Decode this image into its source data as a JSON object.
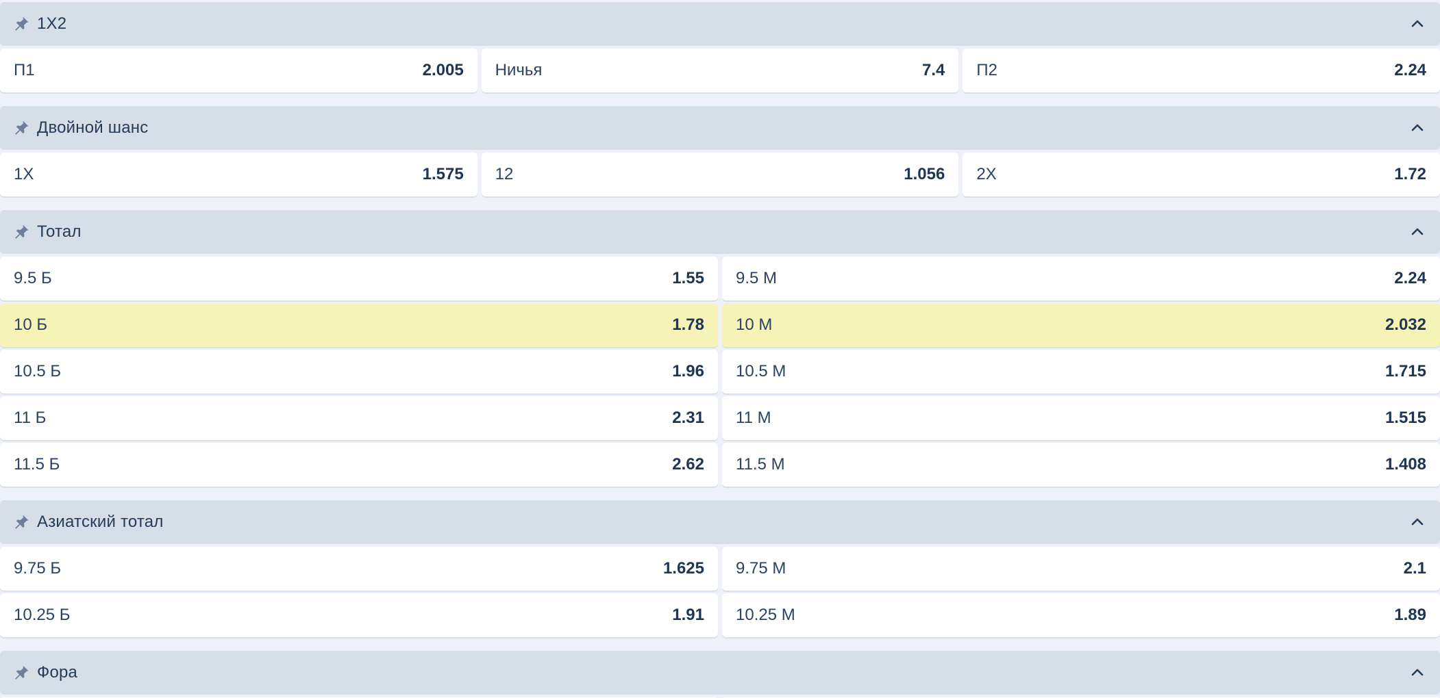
{
  "colors": {
    "header_bg": "#d6dee8",
    "cell_bg": "#ffffff",
    "highlight_bg": "#f5f3b8",
    "text": "#2c4263",
    "page_bg": "#eef2f8"
  },
  "icons": {
    "pin": "pin-icon",
    "collapse": "chevron-up-icon"
  },
  "markets": [
    {
      "title": "1X2",
      "rows": [
        [
          {
            "label": "П1",
            "odd": "2.005"
          },
          {
            "label": "Ничья",
            "odd": "7.4"
          },
          {
            "label": "П2",
            "odd": "2.24"
          }
        ]
      ]
    },
    {
      "title": "Двойной шанс",
      "rows": [
        [
          {
            "label": "1X",
            "odd": "1.575"
          },
          {
            "label": "12",
            "odd": "1.056"
          },
          {
            "label": "2X",
            "odd": "1.72"
          }
        ]
      ]
    },
    {
      "title": "Тотал",
      "rows": [
        [
          {
            "label": "9.5 Б",
            "odd": "1.55"
          },
          {
            "label": "9.5 М",
            "odd": "2.24"
          }
        ],
        [
          {
            "label": "10 Б",
            "odd": "1.78",
            "highlighted": true
          },
          {
            "label": "10 М",
            "odd": "2.032",
            "highlighted": true
          }
        ],
        [
          {
            "label": "10.5 Б",
            "odd": "1.96"
          },
          {
            "label": "10.5 М",
            "odd": "1.715"
          }
        ],
        [
          {
            "label": "11 Б",
            "odd": "2.31"
          },
          {
            "label": "11 М",
            "odd": "1.515"
          }
        ],
        [
          {
            "label": "11.5 Б",
            "odd": "2.62"
          },
          {
            "label": "11.5 М",
            "odd": "1.408"
          }
        ]
      ]
    },
    {
      "title": "Азиатский тотал",
      "rows": [
        [
          {
            "label": "9.75 Б",
            "odd": "1.625"
          },
          {
            "label": "9.75 М",
            "odd": "2.1"
          }
        ],
        [
          {
            "label": "10.25 Б",
            "odd": "1.91"
          },
          {
            "label": "10.25 М",
            "odd": "1.89"
          }
        ]
      ]
    },
    {
      "title": "Фора",
      "rows": []
    }
  ]
}
